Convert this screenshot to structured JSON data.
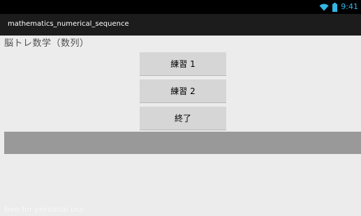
{
  "status_bar": {
    "time": "9:41",
    "icons": [
      "wifi-icon",
      "battery-icon"
    ],
    "accent_color": "#33b5e5"
  },
  "action_bar": {
    "title": "mathematics_numerical_sequence"
  },
  "main": {
    "heading": "脳トレ数学（数列）",
    "buttons": [
      {
        "label": "練習 1"
      },
      {
        "label": "練習 2"
      },
      {
        "label": "終了"
      }
    ]
  },
  "watermark": "free for personal use",
  "colors": {
    "status_bar_bg": "#000000",
    "action_bar_bg": "#1c1c1c",
    "background": "#ececec",
    "button_bg": "#d6d6d6",
    "gray_bar": "#999999"
  }
}
